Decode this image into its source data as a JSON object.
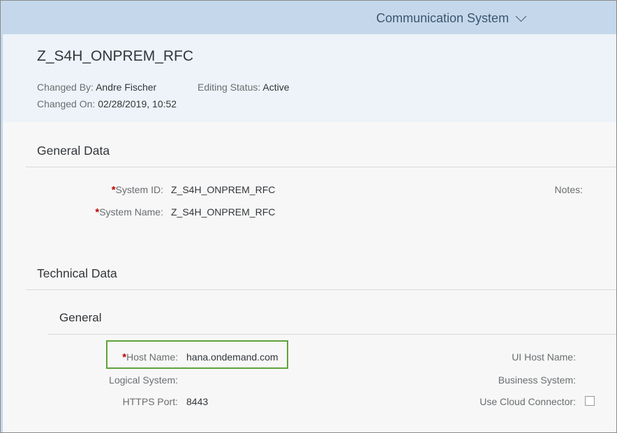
{
  "topbar": {
    "title": "Communication System"
  },
  "header": {
    "object_title": "Z_S4H_ONPREM_RFC",
    "changed_by_label": "Changed By:",
    "changed_by_value": "Andre Fischer",
    "editing_status_label": "Editing Status:",
    "editing_status_value": "Active",
    "changed_on_label": "Changed On:",
    "changed_on_value": "02/28/2019, 10:52"
  },
  "general_data": {
    "title": "General Data",
    "required_marker": "*",
    "system_id_label": "System ID:",
    "system_id_value": "Z_S4H_ONPREM_RFC",
    "system_name_label": "System Name:",
    "system_name_value": "Z_S4H_ONPREM_RFC",
    "notes_label": "Notes:"
  },
  "technical_data": {
    "title": "Technical Data",
    "general": {
      "title": "General",
      "required_marker": "*",
      "host_name_label": "Host Name:",
      "host_name_value": "hana.ondemand.com",
      "logical_system_label": "Logical System:",
      "https_port_label": "HTTPS Port:",
      "https_port_value": "8443",
      "ui_host_name_label": "UI Host Name:",
      "business_system_label": "Business System:",
      "use_cloud_connector_label": "Use Cloud Connector:"
    }
  },
  "colors": {
    "topbar_bg": "#c5d8eb",
    "header_bg": "#edf3f8",
    "required": "#bb0000",
    "highlight_border": "#5fa23a"
  }
}
